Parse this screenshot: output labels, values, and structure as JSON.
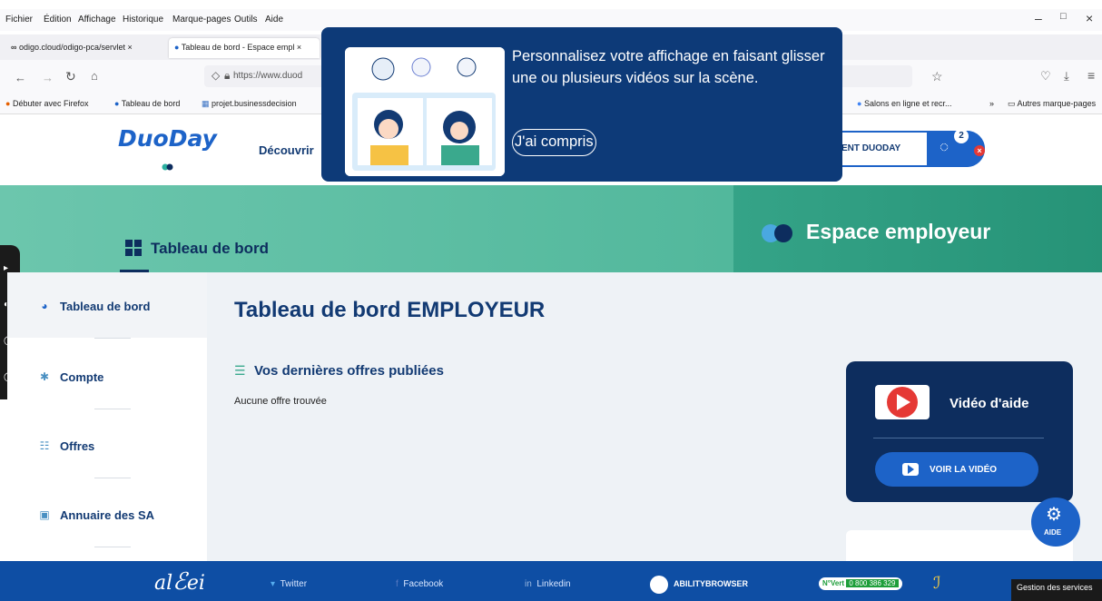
{
  "browser": {
    "menu": [
      "Fichier",
      "Édition",
      "Affichage",
      "Historique",
      "Marque-pages",
      "Outils",
      "Aide"
    ],
    "tabs": [
      {
        "label": "odigo.cloud/odigo-pca/servlet",
        "close": "×"
      },
      {
        "label": "Tableau de bord - Espace empl",
        "close": "×"
      }
    ],
    "url": "https://www.duod",
    "bookmarks": [
      "Débuter avec Firefox",
      "Tableau de bord",
      "projet.businessdecision",
      "Salons en ligne et recr...",
      "Autres marque-pages"
    ],
    "bookmarks_more": "»",
    "window_controls": [
      "–",
      "□",
      "×"
    ]
  },
  "site": {
    "logo": "DuoDay",
    "nav": {
      "discover": "Découvrir",
      "cta": "ENT DUODAY"
    },
    "notif_count": "2",
    "hero": {
      "tab_label": "Tableau de bord",
      "space_label": "Espace employeur"
    }
  },
  "sidebar": {
    "items": [
      {
        "label": "Tableau de bord",
        "icon": "dashboard-icon"
      },
      {
        "label": "Compte",
        "icon": "gear-icon"
      },
      {
        "label": "Offres",
        "icon": "list-icon"
      },
      {
        "label": "Annuaire des SA",
        "icon": "directory-icon"
      }
    ]
  },
  "main": {
    "title": "Tableau de bord EMPLOYEUR",
    "section_title": "Vos dernières offres publiées",
    "empty_text": "Aucune offre trouvée"
  },
  "help": {
    "title": "Vidéo d'aide",
    "button": "VOIR LA VIDÉO",
    "fab": "AIDE"
  },
  "footer": {
    "twitter": "Twitter",
    "facebook": "Facebook",
    "linkedin": "Linkedin",
    "ability": "ABILITYBROWSER",
    "phone_label": "N°Vert",
    "phone": "0 800 386 329",
    "services": "Gestion des services"
  },
  "popup": {
    "text": "Personnalisez votre affichage en faisant glisser une ou plusieurs vidéos sur la scène.",
    "button": "J'ai compris"
  },
  "colors": {
    "brand_blue": "#1d63c8",
    "dark_navy": "#0d2d5e",
    "title_navy": "#123a73",
    "green": "#3aa98d",
    "red": "#e53935"
  }
}
